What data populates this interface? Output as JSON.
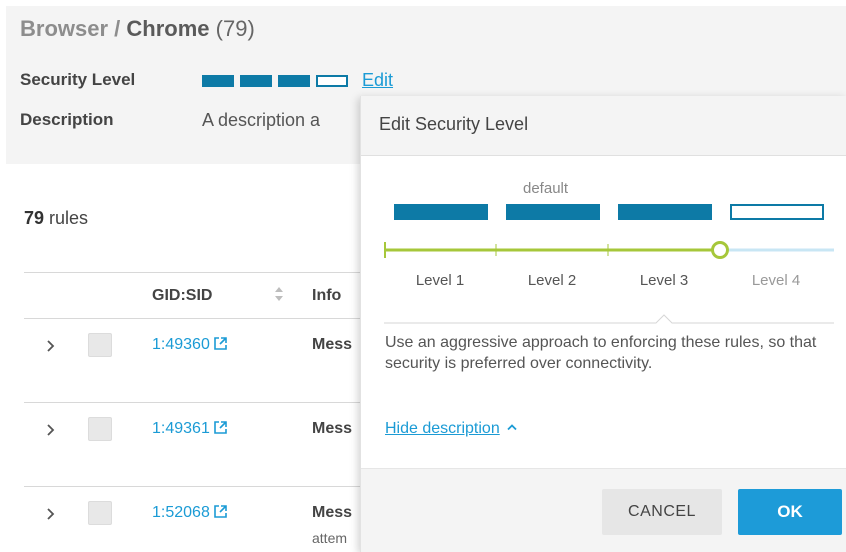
{
  "breadcrumb": {
    "parent": "Browser",
    "separator": " / ",
    "current": "Chrome",
    "count": "(79)"
  },
  "security": {
    "label": "Security Level",
    "edit_label": "Edit",
    "level": 3,
    "max_level": 4
  },
  "description": {
    "label": "Description",
    "text": "A description a"
  },
  "rules": {
    "count": "79",
    "count_suffix": " rules"
  },
  "table": {
    "columns": {
      "gid_sid": "GID:SID",
      "info": "Info"
    },
    "rows": [
      {
        "gid": "1:49360",
        "message": "Mess",
        "sub": ""
      },
      {
        "gid": "1:49361",
        "message": "Mess",
        "sub": ""
      },
      {
        "gid": "1:52068",
        "message": "Mess",
        "sub": "attem"
      }
    ]
  },
  "popover": {
    "title": "Edit Security Level",
    "default_label": "default",
    "levels": [
      "Level 1",
      "Level 2",
      "Level 3",
      "Level 4"
    ],
    "selected_level": 3,
    "description": "Use an aggressive approach to enforcing these rules, so that security is preferred over connectivity.",
    "hide_description": "Hide description",
    "cancel_label": "CANCEL",
    "ok_label": "OK"
  },
  "colors": {
    "accent": "#1d9bd8",
    "level_block": "#0d7aa6",
    "slider_active": "#a6c73a",
    "slider_inactive": "#c8e6f4",
    "link": "#1b9bd5"
  },
  "icons": {
    "chevron": "chevron-right-icon",
    "external": "external-link-icon",
    "sort": "sort-icon",
    "caret": "chevron-up-icon"
  }
}
